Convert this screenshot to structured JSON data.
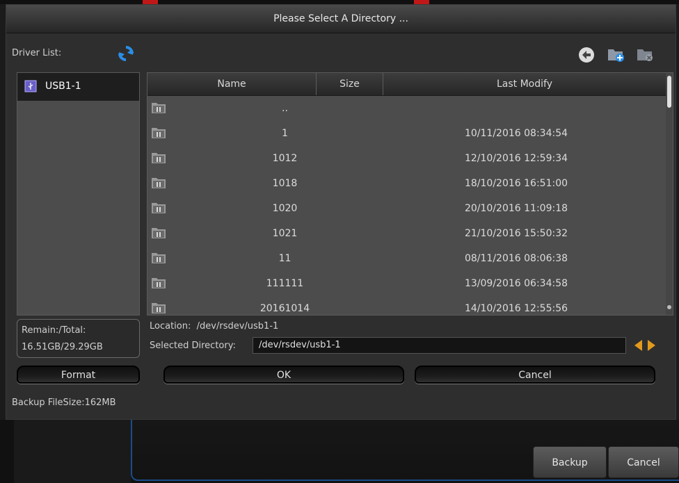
{
  "dialog": {
    "title": "Please Select A Directory ..."
  },
  "drivers": {
    "label": "Driver List:",
    "items": [
      {
        "label": "USB1-1"
      }
    ]
  },
  "file_table": {
    "columns": [
      "Name",
      "Size",
      "Last Modify"
    ],
    "rows": [
      {
        "name": "..",
        "size": "",
        "modified": ""
      },
      {
        "name": "1",
        "size": "",
        "modified": "10/11/2016 08:34:54"
      },
      {
        "name": "1012",
        "size": "",
        "modified": "12/10/2016 12:59:34"
      },
      {
        "name": "1018",
        "size": "",
        "modified": "18/10/2016 16:51:00"
      },
      {
        "name": "1020",
        "size": "",
        "modified": "20/10/2016 11:09:18"
      },
      {
        "name": "1021",
        "size": "",
        "modified": "21/10/2016 15:50:32"
      },
      {
        "name": "11",
        "size": "",
        "modified": "08/11/2016 08:06:38"
      },
      {
        "name": "111111",
        "size": "",
        "modified": "13/09/2016 06:34:58"
      },
      {
        "name": "20161014",
        "size": "",
        "modified": "14/10/2016 12:55:56"
      }
    ]
  },
  "storage": {
    "remain_label": "Remain:/Total:",
    "remain_value": "16.51GB/29.29GB"
  },
  "location": {
    "label": "Location:",
    "value": "/dev/rsdev/usb1-1"
  },
  "selected_directory": {
    "label": "Selected Directory:",
    "value": "/dev/rsdev/usb1-1"
  },
  "buttons": {
    "format": "Format",
    "ok": "OK",
    "cancel": "Cancel"
  },
  "backup_filesize": "Backup FileSize:162MB",
  "bottom_buttons": {
    "backup": "Backup",
    "cancel": "Cancel"
  },
  "icons": {
    "refresh": "refresh-icon",
    "back": "back-arrow-icon",
    "new_folder": "new-folder-icon",
    "delete_folder": "delete-folder-icon",
    "usb": "usb-icon",
    "folder": "folder-icon"
  },
  "colors": {
    "accent_blue": "#1e90ff",
    "arrow_orange": "#e29a1c"
  }
}
